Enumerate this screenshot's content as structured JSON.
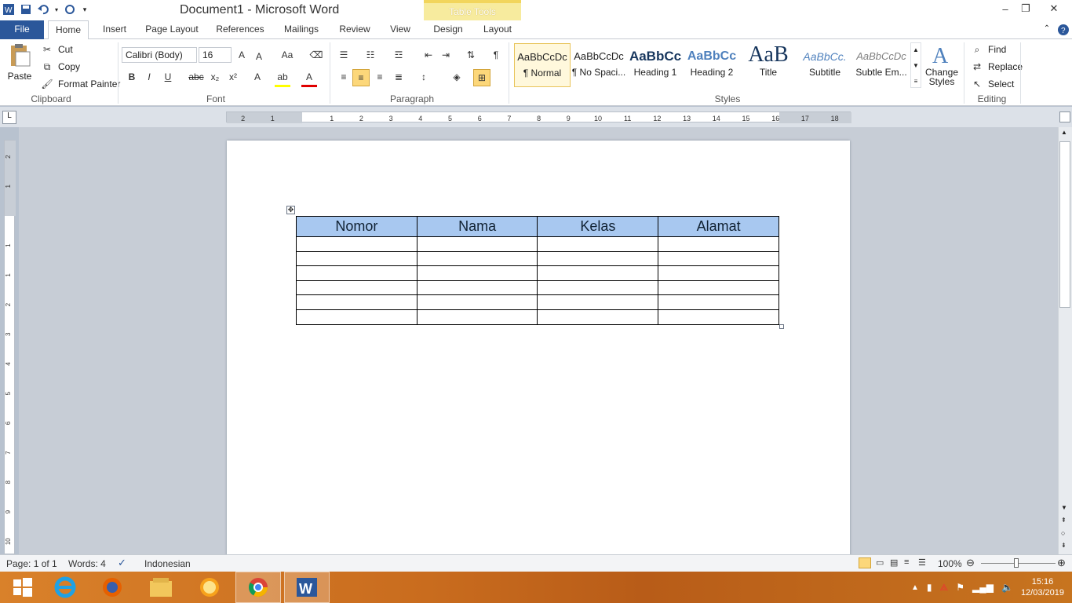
{
  "window": {
    "title": "Document1  -  Microsoft Word",
    "contextual_tab_group": "Table Tools"
  },
  "tabs": [
    "File",
    "Home",
    "Insert",
    "Page Layout",
    "References",
    "Mailings",
    "Review",
    "View",
    "Design",
    "Layout"
  ],
  "clipboard": {
    "paste": "Paste",
    "cut": "Cut",
    "copy": "Copy",
    "format_painter": "Format Painter",
    "label": "Clipboard"
  },
  "font": {
    "name": "Calibri (Body)",
    "size": "16",
    "label": "Font",
    "bold": "B",
    "italic": "I",
    "underline": "U",
    "strike": "abc",
    "subscript": "x₂",
    "superscript": "x²",
    "change_case": "Aa",
    "grow": "A",
    "shrink": "A",
    "text_effects": "A",
    "highlight": "ab",
    "font_color": "A"
  },
  "paragraph": {
    "label": "Paragraph",
    "show_marks": "¶"
  },
  "styles": {
    "label": "Styles",
    "items": [
      {
        "sample": "AaBbCcDc",
        "name": "¶ Normal",
        "color": "#000000"
      },
      {
        "sample": "AaBbCcDc",
        "name": "¶ No Spaci...",
        "color": "#000000"
      },
      {
        "sample": "AaBbCc",
        "name": "Heading 1",
        "color": "#17365d"
      },
      {
        "sample": "AaBbCc",
        "name": "Heading 2",
        "color": "#4f81bd"
      },
      {
        "sample": "AaB",
        "name": "Title",
        "color": "#17365d"
      },
      {
        "sample": "AaBbCc.",
        "name": "Subtitle",
        "color": "#4f81bd"
      },
      {
        "sample": "AaBbCcDc",
        "name": "Subtle Em...",
        "color": "#808080"
      }
    ],
    "change_styles": "Change Styles"
  },
  "editing": {
    "label": "Editing",
    "find": "Find",
    "replace": "Replace",
    "select": "Select"
  },
  "table": {
    "headers": [
      "Nomor",
      "Nama",
      "Kelas",
      "Alamat"
    ],
    "empty_rows": 6
  },
  "hruler_numbers": [
    "2",
    "1",
    "1",
    "2",
    "3",
    "4",
    "5",
    "6",
    "7",
    "8",
    "9",
    "10",
    "11",
    "12",
    "13",
    "14",
    "15",
    "16",
    "17",
    "18"
  ],
  "vruler_numbers": [
    "2",
    "1",
    "1",
    "1",
    "2",
    "3",
    "4",
    "5",
    "6",
    "7",
    "8",
    "9",
    "10",
    "11"
  ],
  "status": {
    "page": "Page: 1 of 1",
    "words": "Words: 4",
    "language": "Indonesian",
    "zoom": "100%"
  },
  "clock": {
    "time": "15:16",
    "date": "12/03/2019"
  },
  "colors": {
    "file_tab": "#2b579a",
    "header_fill": "#a8c8f0",
    "table_tools": "#f7eb9e",
    "taskbar": "#c96c1e"
  }
}
